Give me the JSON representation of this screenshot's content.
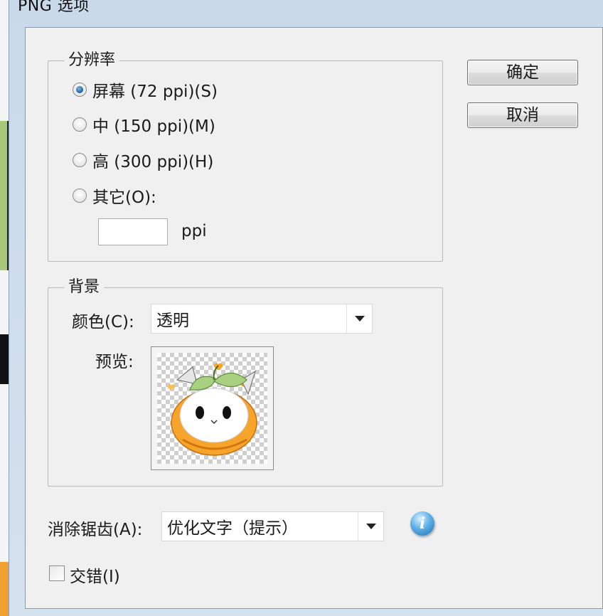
{
  "window": {
    "title": "PNG 选项"
  },
  "resolution": {
    "legend": "分辨率",
    "options": [
      {
        "label": "屏幕 (72 ppi)(S)",
        "checked": true
      },
      {
        "label": "中 (150 ppi)(M)",
        "checked": false
      },
      {
        "label": "高 (300 ppi)(H)",
        "checked": false
      },
      {
        "label": "其它(O):",
        "checked": false
      }
    ],
    "custom_value": "",
    "unit": "ppi"
  },
  "background": {
    "legend": "背景",
    "color_label": "颜色(C):",
    "color_value": "透明",
    "preview_label": "预览:"
  },
  "antialias": {
    "label": "消除锯齿(A):",
    "value": "优化文字（提示）"
  },
  "interlace": {
    "label": "交错(I)",
    "checked": false
  },
  "buttons": {
    "ok": "确定",
    "cancel": "取消"
  },
  "icons": {
    "info": "info-icon",
    "dropdown": "chevron-down-icon"
  },
  "colors": {
    "window_frame": "#d0deec",
    "client": "#f0f0f0",
    "radio_selected": "#1f5d9e"
  }
}
